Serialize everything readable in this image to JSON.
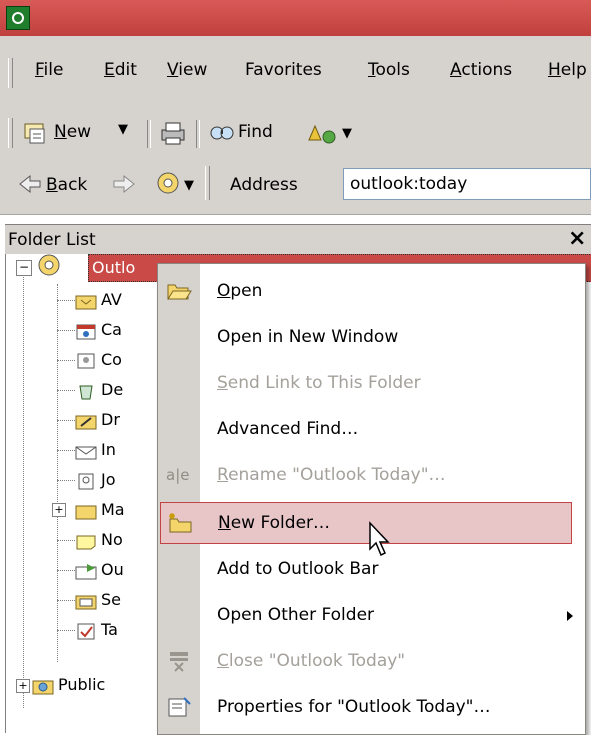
{
  "menubar": {
    "items": [
      "File",
      "Edit",
      "View",
      "Favorites",
      "Tools",
      "Actions",
      "Help"
    ]
  },
  "toolbar": {
    "new_label": "New",
    "find_label": "Find"
  },
  "navbar": {
    "back_label": "Back",
    "address_label": "Address",
    "address_value": "outlook:today"
  },
  "folder_list": {
    "title": "Folder List",
    "close_glyph": "×",
    "root_label": "Outlo",
    "items": [
      "AV",
      "Ca",
      "Co",
      "De",
      "Dr",
      "In",
      "Jo",
      "Ma",
      "No",
      "Ou",
      "Se",
      "Ta"
    ],
    "public_label": "Public"
  },
  "context_menu": {
    "items": [
      {
        "label": "Open",
        "icon": "open-folder-icon",
        "state": "enabled"
      },
      {
        "label": "Open in New Window",
        "icon": "",
        "state": "enabled"
      },
      {
        "label": "Send Link to This Folder",
        "icon": "",
        "state": "disabled"
      },
      {
        "label": "Advanced Find…",
        "icon": "",
        "state": "enabled"
      },
      {
        "label": "Rename \"Outlook Today\"…",
        "icon": "rename-icon",
        "state": "disabled"
      },
      {
        "label": "New Folder…",
        "icon": "new-folder-icon",
        "state": "highlighted"
      },
      {
        "label": "Add to Outlook Bar",
        "icon": "",
        "state": "enabled"
      },
      {
        "label": "Open Other Folder",
        "icon": "",
        "state": "enabled",
        "submenu": true
      },
      {
        "label": "Close \"Outlook Today\"",
        "icon": "close-folder-icon",
        "state": "disabled"
      },
      {
        "label": "Properties for \"Outlook Today\"…",
        "icon": "properties-icon",
        "state": "enabled"
      }
    ]
  },
  "colors": {
    "titlebar": "#c8494b",
    "highlight_bg": "#e8c6c8",
    "highlight_border": "#c14343",
    "chrome": "#d6d3ce"
  }
}
